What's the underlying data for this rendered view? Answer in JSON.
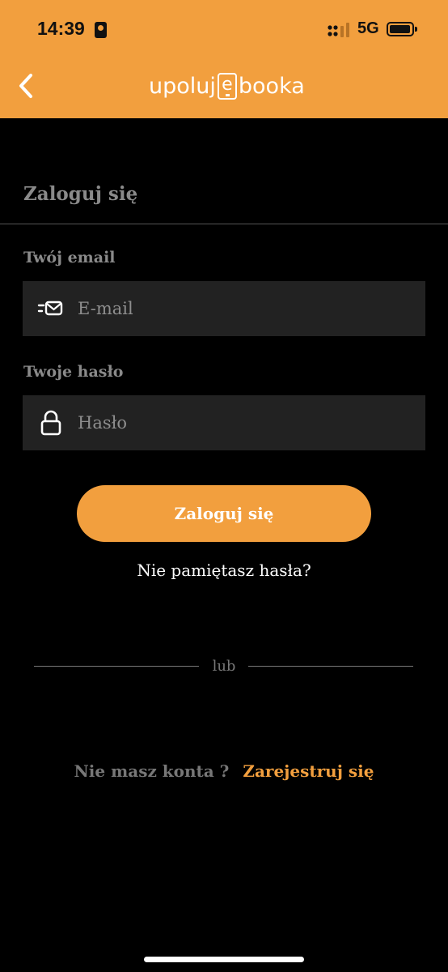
{
  "status_bar": {
    "time": "14:39",
    "network": "5G"
  },
  "header": {
    "logo_prefix": "upoluj",
    "logo_e": "e",
    "logo_suffix": "booka"
  },
  "page": {
    "title": "Zaloguj się"
  },
  "email": {
    "label": "Twój email",
    "placeholder": "E-mail",
    "value": ""
  },
  "password": {
    "label": "Twoje hasło",
    "placeholder": "Hasło",
    "value": ""
  },
  "actions": {
    "login_label": "Zaloguj się",
    "forgot_label": "Nie pamiętasz hasła?",
    "divider_label": "lub",
    "no_account_label": "Nie masz konta ?",
    "register_label": "Zarejestruj się"
  },
  "colors": {
    "accent": "#f29f3e",
    "background": "#000000",
    "input_bg": "#222222",
    "muted_text": "#8a8a8a"
  },
  "icons": [
    "back-chevron-icon",
    "email-icon",
    "lock-icon",
    "battery-icon",
    "signal-icon",
    "portrait-lock-icon"
  ]
}
